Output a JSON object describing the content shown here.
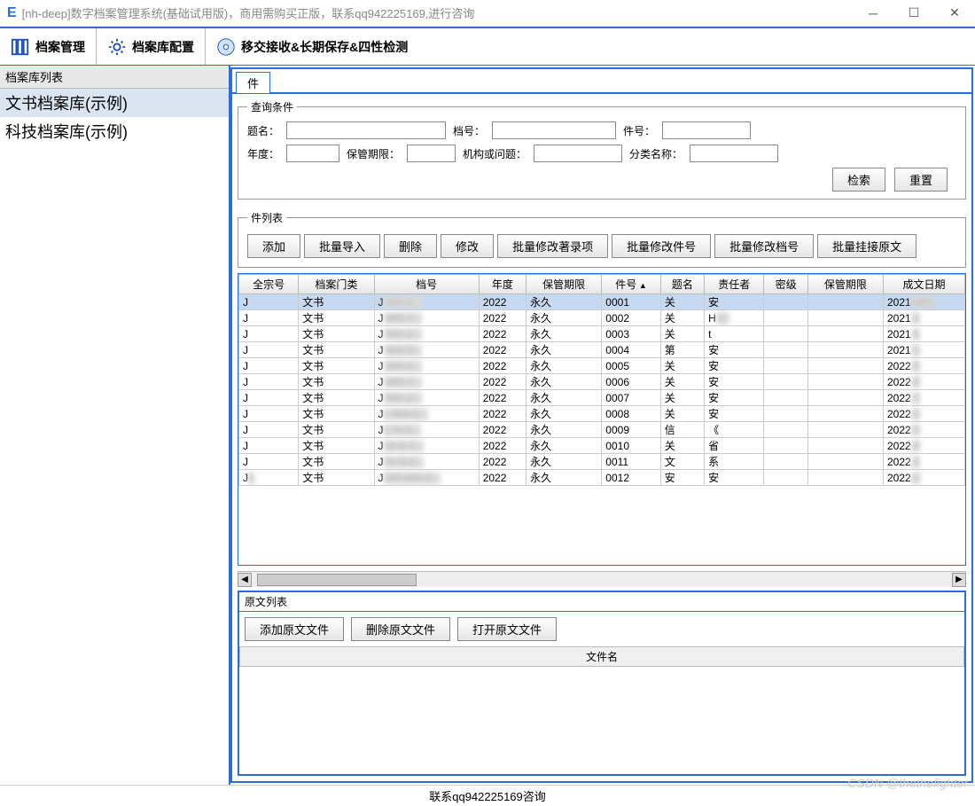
{
  "window": {
    "app_icon": "E",
    "title": "[nh-deep]数字档案管理系统(基础试用版)，商用需购买正版，联系qq942225169,进行咨询"
  },
  "toolbar": {
    "items": [
      {
        "label": "档案管理"
      },
      {
        "label": "档案库配置"
      },
      {
        "label": "移交接收&长期保存&四性检测"
      }
    ]
  },
  "sidebar": {
    "title": "档案库列表",
    "items": [
      {
        "label": "文书档案库(示例)",
        "selected": true
      },
      {
        "label": "科技档案库(示例)",
        "selected": false
      }
    ]
  },
  "tabs": {
    "active": "件"
  },
  "query": {
    "legend": "查询条件",
    "labels": {
      "title": "题名：",
      "doc_no": "档号：",
      "item_no": "件号：",
      "year": "年度：",
      "retention": "保管期限：",
      "org_or_issue": "机构或问题：",
      "category": "分类名称："
    },
    "buttons": {
      "search": "检索",
      "reset": "重置"
    }
  },
  "list": {
    "legend": "件列表",
    "actions": {
      "add": "添加",
      "import": "批量导入",
      "delete": "删除",
      "edit": "修改",
      "batch_author": "批量修改著录项",
      "batch_item": "批量修改件号",
      "batch_doc": "批量修改档号",
      "batch_attach": "批量挂接原文"
    },
    "columns": [
      "全宗号",
      "档案门类",
      "档号",
      "年度",
      "保管期限",
      "件号",
      "题名",
      "责任者",
      "密级",
      "保管期限",
      "成文日期"
    ],
    "sort_col_index": 5,
    "rows": [
      {
        "cells": [
          "J",
          "文书",
          "J   WS-2...",
          "2022",
          "永久",
          "0001",
          "关",
          "安",
          "",
          "",
          "20211001"
        ],
        "selected": true
      },
      {
        "cells": [
          "J",
          "文书",
          "J   WS-2...",
          "2022",
          "永久",
          "0002",
          "关",
          "H (  )",
          "",
          "",
          "2021    1"
        ]
      },
      {
        "cells": [
          "J",
          "文书",
          "J   WS-2...",
          "2022",
          "永久",
          "0003",
          "关",
          "t",
          "",
          "",
          "2021    1"
        ]
      },
      {
        "cells": [
          "J",
          "文书",
          "J   WS-2...",
          "2022",
          "永久",
          "0004",
          "第",
          "安",
          "",
          "",
          "2021    1"
        ]
      },
      {
        "cells": [
          "J",
          "文书",
          "J   WS-2...",
          "2022",
          "永久",
          "0005",
          "关",
          "安",
          "",
          "",
          "2022    5"
        ]
      },
      {
        "cells": [
          "J",
          "文书",
          "J   WS-2...",
          "2022",
          "永久",
          "0006",
          "关",
          "安",
          "",
          "",
          "2022    5"
        ]
      },
      {
        "cells": [
          "J",
          "文书",
          "J   WS-2...",
          "2022",
          "永久",
          "0007",
          "关",
          "安",
          "",
          "",
          "2022    7"
        ]
      },
      {
        "cells": [
          "J",
          "文书",
          "J1  WS-2...",
          "2022",
          "永久",
          "0008",
          "关",
          "安",
          "",
          "",
          "2022    0"
        ]
      },
      {
        "cells": [
          "J",
          "文书",
          "J1  /S-2...",
          "2022",
          "永久",
          "0009",
          "信",
          "《  ",
          "",
          "",
          "2022    0"
        ]
      },
      {
        "cells": [
          "J",
          "文书",
          "J19   S-2...",
          "2022",
          "永久",
          "0010",
          "关",
          "省",
          "",
          "",
          "2022    0"
        ]
      },
      {
        "cells": [
          "J",
          "文书",
          "J19   S-2...",
          "2022",
          "永久",
          "0011",
          "文",
          "系",
          "",
          "",
          "2022    2"
        ]
      },
      {
        "cells": [
          "J1",
          "文书",
          "J195-WS-2...",
          "2022",
          "永久",
          "0012",
          "安",
          "安",
          "",
          "",
          "2022    3"
        ]
      }
    ]
  },
  "originals": {
    "legend": "原文列表",
    "actions": {
      "add": "添加原文文件",
      "delete": "删除原文文件",
      "open": "打开原文文件"
    },
    "filename_col": "文件名"
  },
  "status": {
    "text": "联系qq942225169咨询"
  },
  "watermark": "CSDN @thethefighter"
}
